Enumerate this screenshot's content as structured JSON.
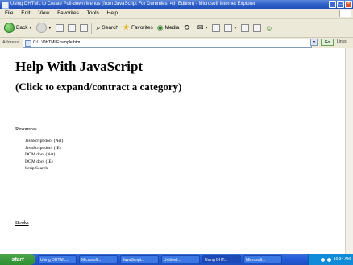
{
  "window": {
    "title": "Using DHTML to Create Pull-down Menus (from JavaScript For Dummies, 4th Edition) - Microsoft Internet Explorer"
  },
  "menu": {
    "items": [
      "File",
      "Edit",
      "View",
      "Favorites",
      "Tools",
      "Help"
    ]
  },
  "toolbar": {
    "back_label": "Back",
    "search_label": "Search",
    "favorites_label": "Favorites",
    "media_label": "Media"
  },
  "address": {
    "label": "Address",
    "url": "C:\\...\\DHTMLExample.htm",
    "go_label": "Go",
    "links_label": "Links"
  },
  "page": {
    "heading": "Help With JavaScript",
    "subheading": "(Click to expand/contract a category)",
    "section_resources": "Resources",
    "resources": [
      "JavaScript docs (Net)",
      "JavaScript docs (IE)",
      "DOM docs (Net)",
      "DOM docs (IE)",
      "ScriptSearch"
    ],
    "section_books": "Books"
  },
  "taskbar": {
    "start_label": "start",
    "tasks": [
      "Using DHTML...",
      "Microsoft...",
      "JavaScript...",
      "Untitled...",
      "Using DHT...",
      "Microsoft..."
    ],
    "clock": "10:34 AM"
  }
}
